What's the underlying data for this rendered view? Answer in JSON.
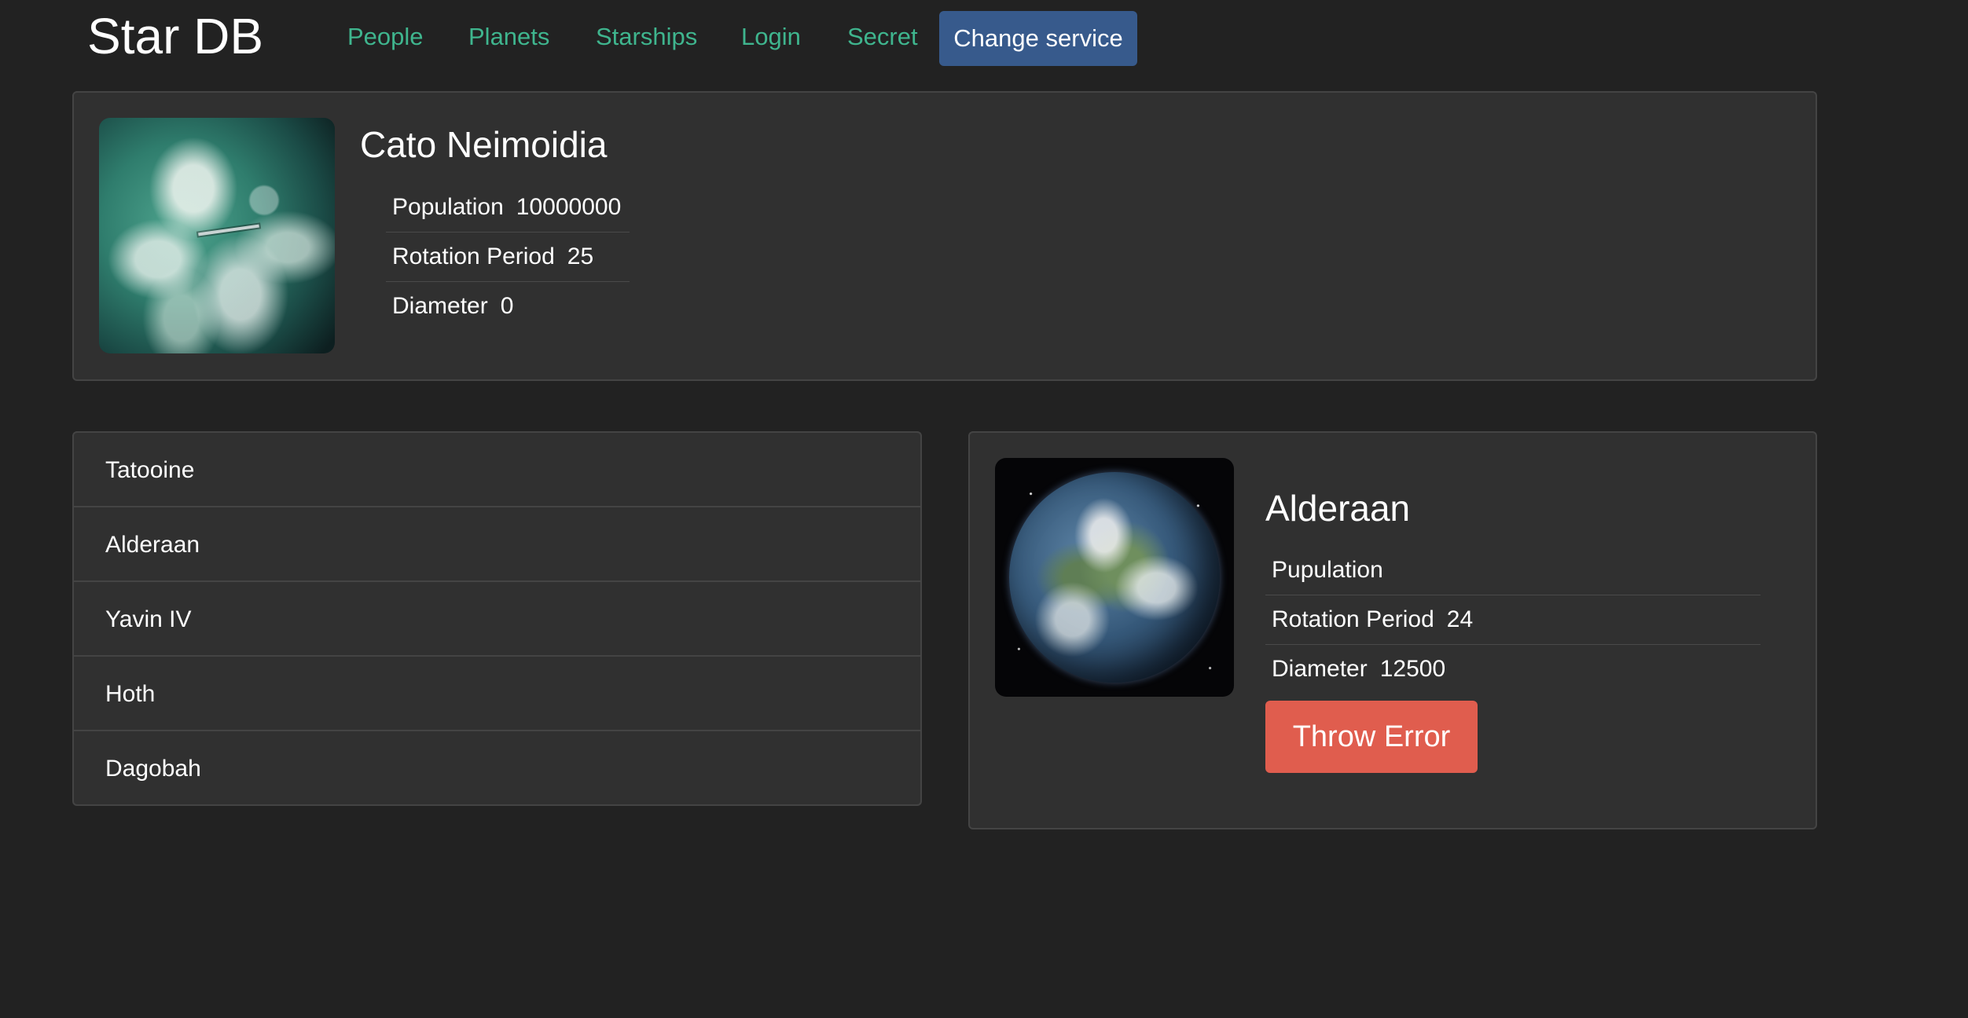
{
  "header": {
    "brand": "Star DB",
    "nav": {
      "people": "People",
      "planets": "Planets",
      "starships": "Starships",
      "login": "Login",
      "secret": "Secret"
    },
    "change_service_label": "Change service"
  },
  "random_planet": {
    "name": "Cato Neimoidia",
    "image_icon": "planet-icon",
    "stats": [
      {
        "label": "Population",
        "value": "10000000"
      },
      {
        "label": "Rotation Period",
        "value": "25"
      },
      {
        "label": "Diameter",
        "value": "0"
      }
    ]
  },
  "planet_list": {
    "items": [
      {
        "label": "Tatooine"
      },
      {
        "label": "Alderaan"
      },
      {
        "label": "Yavin IV"
      },
      {
        "label": "Hoth"
      },
      {
        "label": "Dagobah"
      }
    ]
  },
  "planet_details": {
    "name": "Alderaan",
    "image_icon": "planet-icon",
    "stats": [
      {
        "label": "Pupulation",
        "value": ""
      },
      {
        "label": "Rotation Period",
        "value": "24"
      },
      {
        "label": "Diameter",
        "value": "12500"
      }
    ],
    "throw_error_label": "Throw Error"
  },
  "colors": {
    "background": "#222222",
    "card": "#303030",
    "nav_link": "#3fb58e",
    "primary_button": "#375a8c",
    "danger_button": "#e05d4e"
  }
}
